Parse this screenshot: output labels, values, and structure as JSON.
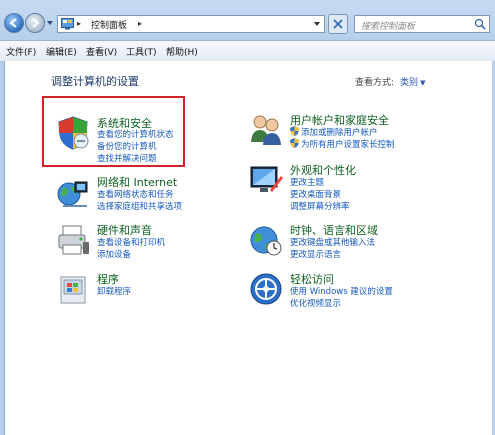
{
  "address_bar": {
    "crumb": "控制面板",
    "sep": "▸"
  },
  "search": {
    "placeholder": "搜索控制面板"
  },
  "menu": [
    "文件(F)",
    "编辑(E)",
    "查看(V)",
    "工具(T)",
    "帮助(H)"
  ],
  "page": {
    "title": "调整计算机的设置",
    "view_by_label": "查看方式:",
    "view_by_value": "类别"
  },
  "categories": {
    "system_security": {
      "title": "系统和安全",
      "links": [
        "查看您的计算机状态",
        "备份您的计算机",
        "查找并解决问题"
      ]
    },
    "network": {
      "title": "网络和 Internet",
      "links": [
        "查看网络状态和任务",
        "选择家庭组和共享选项"
      ]
    },
    "hardware_sound": {
      "title": "硬件和声音",
      "links": [
        "查看设备和打印机",
        "添加设备"
      ]
    },
    "programs": {
      "title": "程序",
      "links": [
        "卸载程序"
      ]
    },
    "user_accounts": {
      "title": "用户帐户和家庭安全",
      "links": [
        "添加或删除用户帐户",
        "为所有用户设置家长控制"
      ]
    },
    "appearance": {
      "title": "外观和个性化",
      "links": [
        "更改主题",
        "更改桌面背景",
        "调整屏幕分辨率"
      ]
    },
    "clock_region": {
      "title": "时钟、语言和区域",
      "links": [
        "更改键盘或其他输入法",
        "更改显示语言"
      ]
    },
    "ease_of_access": {
      "title": "轻松访问",
      "links": [
        "使用 Windows 建议的设置",
        "优化视频显示"
      ]
    }
  },
  "colors": {
    "link": "#1659c0",
    "category_title": "#0d5f20",
    "highlight": "#d1232a"
  }
}
